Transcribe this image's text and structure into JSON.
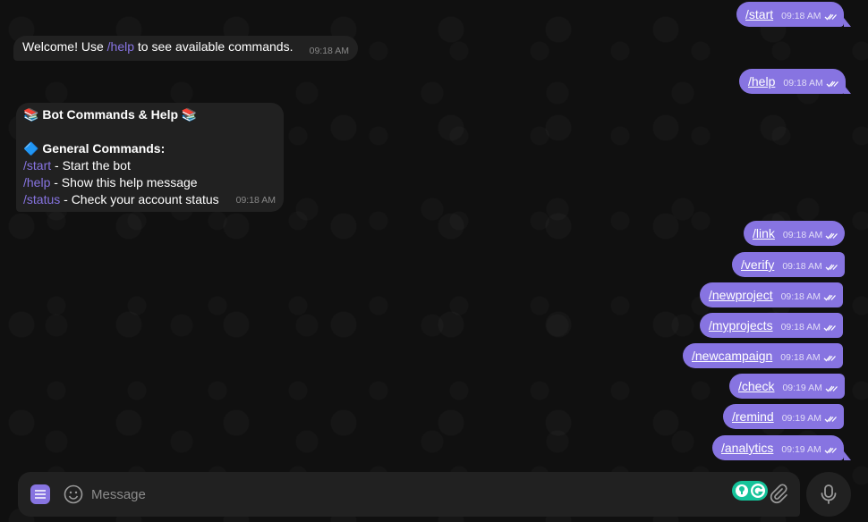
{
  "outgoing": [
    {
      "cmd": "/start",
      "time": "09:18 AM"
    },
    {
      "cmd": "/help",
      "time": "09:18 AM"
    },
    {
      "cmd": "/link",
      "time": "09:18 AM"
    },
    {
      "cmd": "/verify",
      "time": "09:18 AM"
    },
    {
      "cmd": "/newproject",
      "time": "09:18 AM"
    },
    {
      "cmd": "/myprojects",
      "time": "09:18 AM"
    },
    {
      "cmd": "/newcampaign",
      "time": "09:18 AM"
    },
    {
      "cmd": "/check",
      "time": "09:19 AM"
    },
    {
      "cmd": "/remind",
      "time": "09:19 AM"
    },
    {
      "cmd": "/analytics",
      "time": "09:19 AM"
    }
  ],
  "welcome": {
    "prefix": "Welcome! Use ",
    "link": "/help",
    "suffix": " to see available commands.",
    "time": "09:18 AM"
  },
  "help": {
    "title_emoji": "📚",
    "title": "Bot Commands & Help",
    "section_emoji": "🔷",
    "section": "General Commands:",
    "commands": [
      {
        "cmd": "/start",
        "desc": " - Start the bot"
      },
      {
        "cmd": "/help",
        "desc": " - Show this help message"
      },
      {
        "cmd": "/status",
        "desc": " - Check your account status"
      }
    ],
    "time": "09:18 AM"
  },
  "composer": {
    "placeholder": "Message"
  },
  "colors": {
    "accent": "#8774e1",
    "bubble_in": "#212121",
    "background": "#101010"
  }
}
